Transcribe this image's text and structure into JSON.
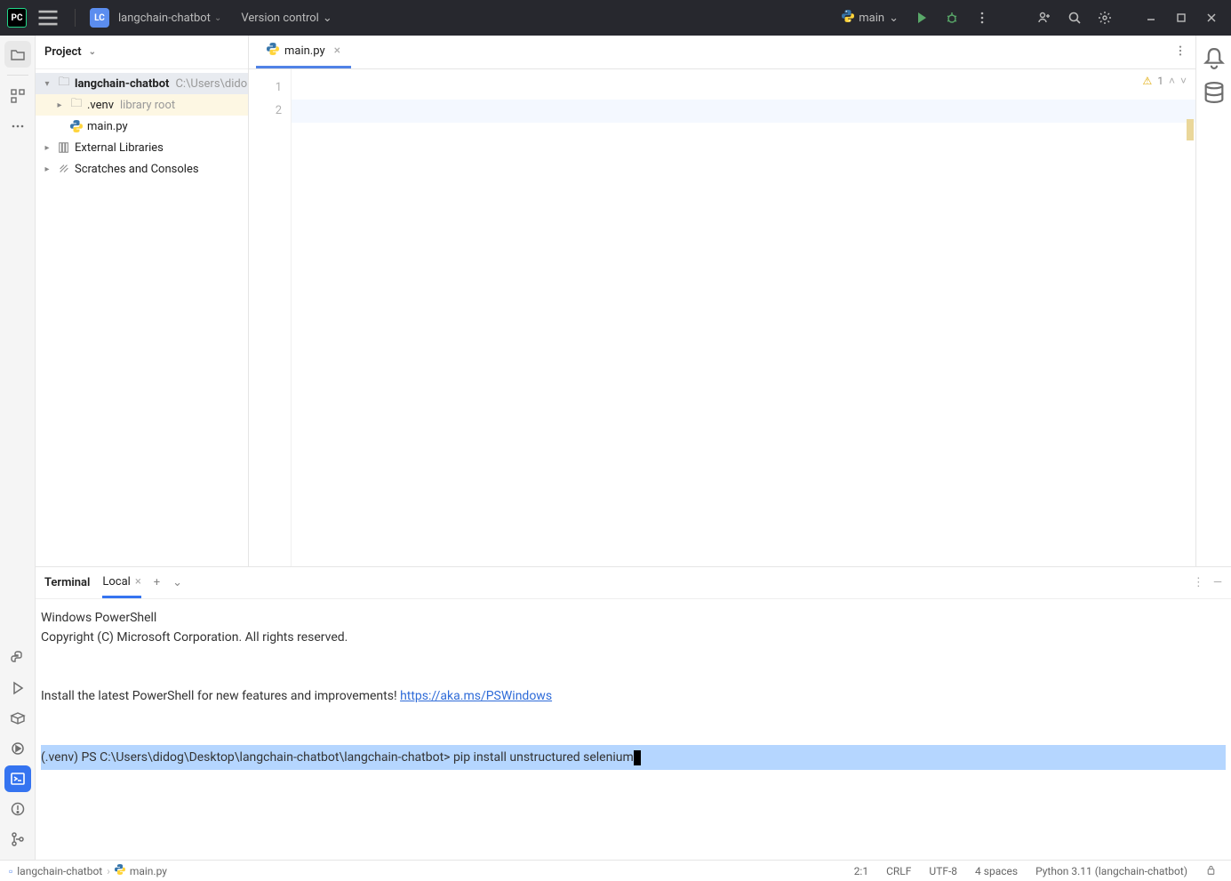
{
  "titlebar": {
    "logo": "PC",
    "project_badge": "LC",
    "project_name": "langchain-chatbot",
    "version_control": "Version control",
    "run_config": "main"
  },
  "project": {
    "header": "Project",
    "tree": {
      "root_name": "langchain-chatbot",
      "root_path": "C:\\Users\\dido",
      "venv": ".venv",
      "venv_tag": "library root",
      "file": "main.py",
      "ext_libs": "External Libraries",
      "scratches": "Scratches and Consoles"
    }
  },
  "editor": {
    "tab_file": "main.py",
    "line_numbers": [
      "1",
      "2"
    ],
    "warning_count": "1"
  },
  "terminal": {
    "tab_main": "Terminal",
    "tab_local": "Local",
    "lines": {
      "l1": "Windows PowerShell",
      "l2": "Copyright (C) Microsoft Corporation. All rights reserved.",
      "l3a": "Install the latest PowerShell for new features and improvements! ",
      "l3_link": "https://aka.ms/PSWindows",
      "prompt": "(.venv) PS C:\\Users\\didog\\Desktop\\langchain-chatbot\\langchain-chatbot> pip install unstructured selenium"
    }
  },
  "statusbar": {
    "breadcrumb_root": "langchain-chatbot",
    "breadcrumb_file": "main.py",
    "pos": "2:1",
    "line_sep": "CRLF",
    "encoding": "UTF-8",
    "indent": "4 spaces",
    "interpreter": "Python 3.11 (langchain-chatbot)"
  }
}
